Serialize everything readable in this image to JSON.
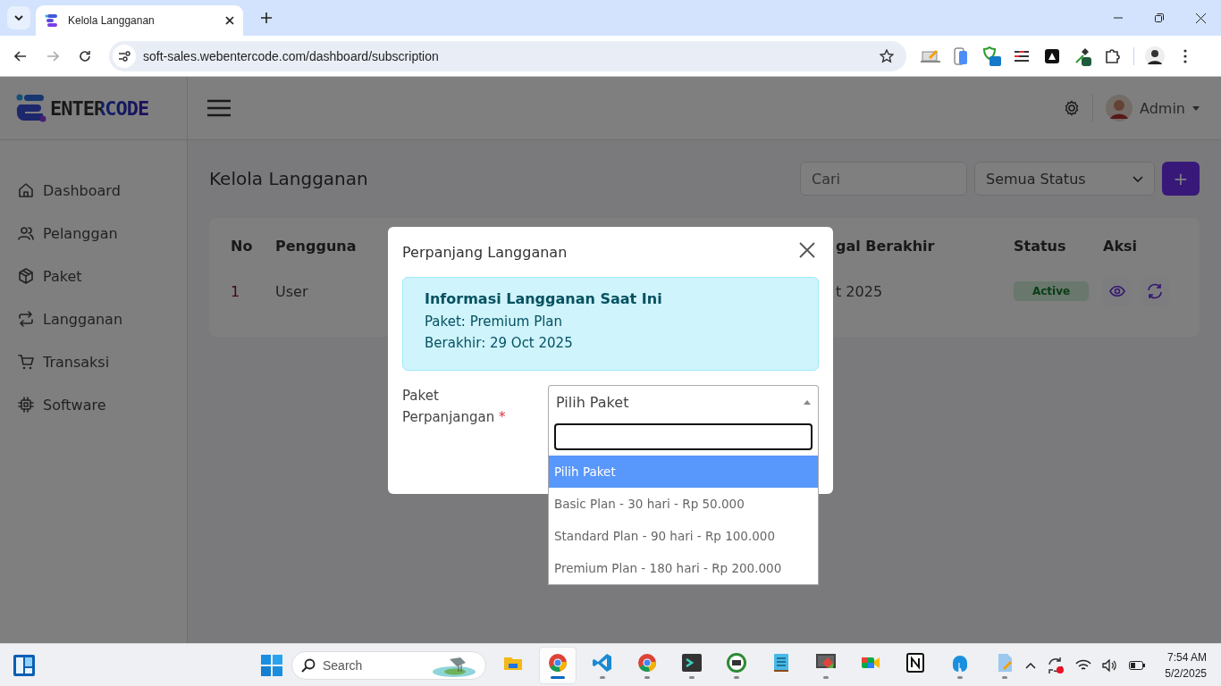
{
  "browser": {
    "tab_title": "Kelola Langganan",
    "url": "soft-sales.webentercode.com/dashboard/subscription"
  },
  "app": {
    "logo": "ENTERCODE",
    "user": "Admin"
  },
  "sidebar": {
    "items": [
      {
        "kind": "home",
        "label": "Dashboard"
      },
      {
        "kind": "users",
        "label": "Pelanggan"
      },
      {
        "kind": "box",
        "label": "Paket"
      },
      {
        "kind": "repeat",
        "label": "Langganan"
      },
      {
        "kind": "cart",
        "label": "Transaksi"
      },
      {
        "kind": "chip",
        "label": "Software"
      }
    ]
  },
  "page": {
    "title": "Kelola Langganan",
    "search": {
      "placeholder": "Cari"
    },
    "status_filter": "Semua Status",
    "add_button": "+"
  },
  "table": {
    "columns": [
      "No",
      "Pengguna",
      "gal Berakhir",
      "Status",
      "Aksi"
    ],
    "rows": [
      {
        "no": "1",
        "user": "User",
        "end": "t 2025",
        "status": "Active"
      }
    ]
  },
  "modal": {
    "title": "Perpanjang Langganan",
    "info": {
      "heading": "Informasi Langganan Saat Ini",
      "lines": [
        "Paket: Premium Plan",
        "Berakhir: 29 Oct 2025"
      ]
    },
    "field": {
      "label": "Paket Perpanjangan",
      "required_mark": "*",
      "value": "Pilih Paket",
      "expanded": true
    },
    "options": [
      {
        "label": "Pilih Paket",
        "selected": true
      },
      {
        "label": "Basic Plan - 30 hari - Rp 50.000",
        "selected": false
      },
      {
        "label": "Standard Plan - 90 hari - Rp 100.000",
        "selected": false
      },
      {
        "label": "Premium Plan - 180 hari - Rp 200.000",
        "selected": false
      }
    ]
  },
  "taskbar": {
    "search": {
      "placeholder": "Search"
    },
    "time": "7:54 AM",
    "date": "5/2/2025",
    "apps": [
      {
        "kind": "files",
        "running": false,
        "active": false
      },
      {
        "kind": "chrome",
        "running": true,
        "active": true
      },
      {
        "kind": "vscode",
        "running": true,
        "active": false
      },
      {
        "kind": "chrome",
        "running": true,
        "active": false
      },
      {
        "kind": "terminal",
        "running": true,
        "active": false
      },
      {
        "kind": "hs",
        "running": true,
        "active": false
      },
      {
        "kind": "notepad",
        "running": false,
        "active": false
      },
      {
        "kind": "tool",
        "running": true,
        "active": false
      },
      {
        "kind": "meet",
        "running": false,
        "active": false
      },
      {
        "kind": "notion",
        "running": false,
        "active": false
      },
      {
        "kind": "db",
        "running": true,
        "active": false
      },
      {
        "kind": "editor",
        "running": true,
        "active": false
      }
    ]
  }
}
